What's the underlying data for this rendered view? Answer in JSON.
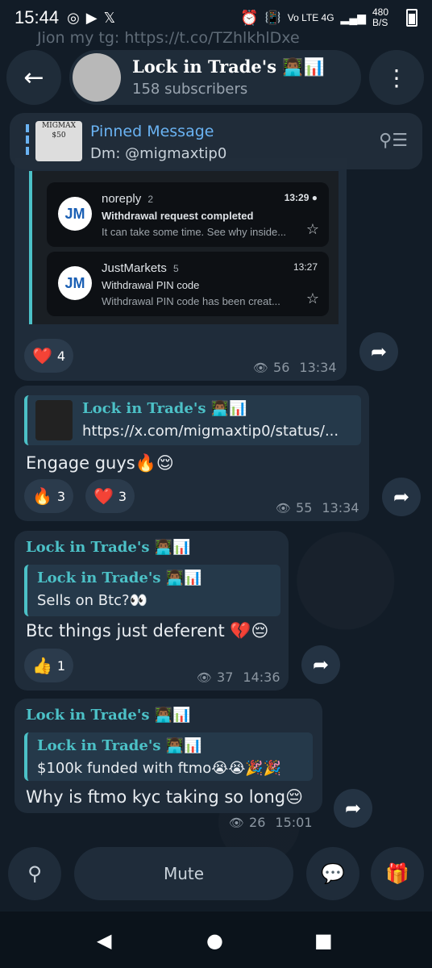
{
  "status_bar": {
    "time": "15:44",
    "network": "Vo LTE 4G",
    "speed": "480 B/S"
  },
  "background_text": "Jion my tg: https://t.co/TZhlkhlDxe",
  "header": {
    "title": "Lock in Trade's 👨🏾‍💻📊",
    "subscribers": "158 subscribers"
  },
  "pinned": {
    "title": "Pinned Message",
    "text": "Dm:  @migmaxtip0",
    "thumb_text": "MIGMAX $50"
  },
  "messages": [
    {
      "emails": [
        {
          "avatar": "JM",
          "from": "noreply",
          "count": "2",
          "time": "13:29",
          "subject": "Withdrawal request completed",
          "preview": "It can take some time. See why inside..."
        },
        {
          "avatar": "JM",
          "from": "JustMarkets",
          "count": "5",
          "time": "13:27",
          "subject": "Withdrawal PIN code",
          "preview": "Withdrawal PIN code has been creat..."
        }
      ],
      "reactions": [
        {
          "emoji": "❤️",
          "count": "4"
        }
      ],
      "views": "56",
      "time": "13:34"
    },
    {
      "link_title": "Lock in Trade's 👨🏾‍💻📊",
      "link_url": "https://x.com/migmaxtip0/status/...",
      "text": "Engage guys🔥😌",
      "reactions": [
        {
          "emoji": "🔥",
          "count": "3"
        },
        {
          "emoji": "❤️",
          "count": "3"
        }
      ],
      "views": "55",
      "time": "13:34"
    },
    {
      "sender": "Lock in Trade's 👨🏾‍💻📊",
      "quote_sender": "Lock in Trade's 👨🏾‍💻📊",
      "quote_text": "Sells on Btc?👀",
      "text": "Btc things just deferent 💔😔",
      "reactions": [
        {
          "emoji": "👍",
          "count": "1"
        }
      ],
      "views": "37",
      "time": "14:36"
    },
    {
      "sender": "Lock in Trade's 👨🏾‍💻📊",
      "quote_sender": "Lock in Trade's 👨🏾‍💻📊",
      "quote_text": "$100k funded with ftmo😭😭🎉🎉",
      "text": "Why is ftmo kyc taking so long😔",
      "views": "26",
      "time": "15:01"
    }
  ],
  "bottom": {
    "mute_label": "Mute"
  }
}
